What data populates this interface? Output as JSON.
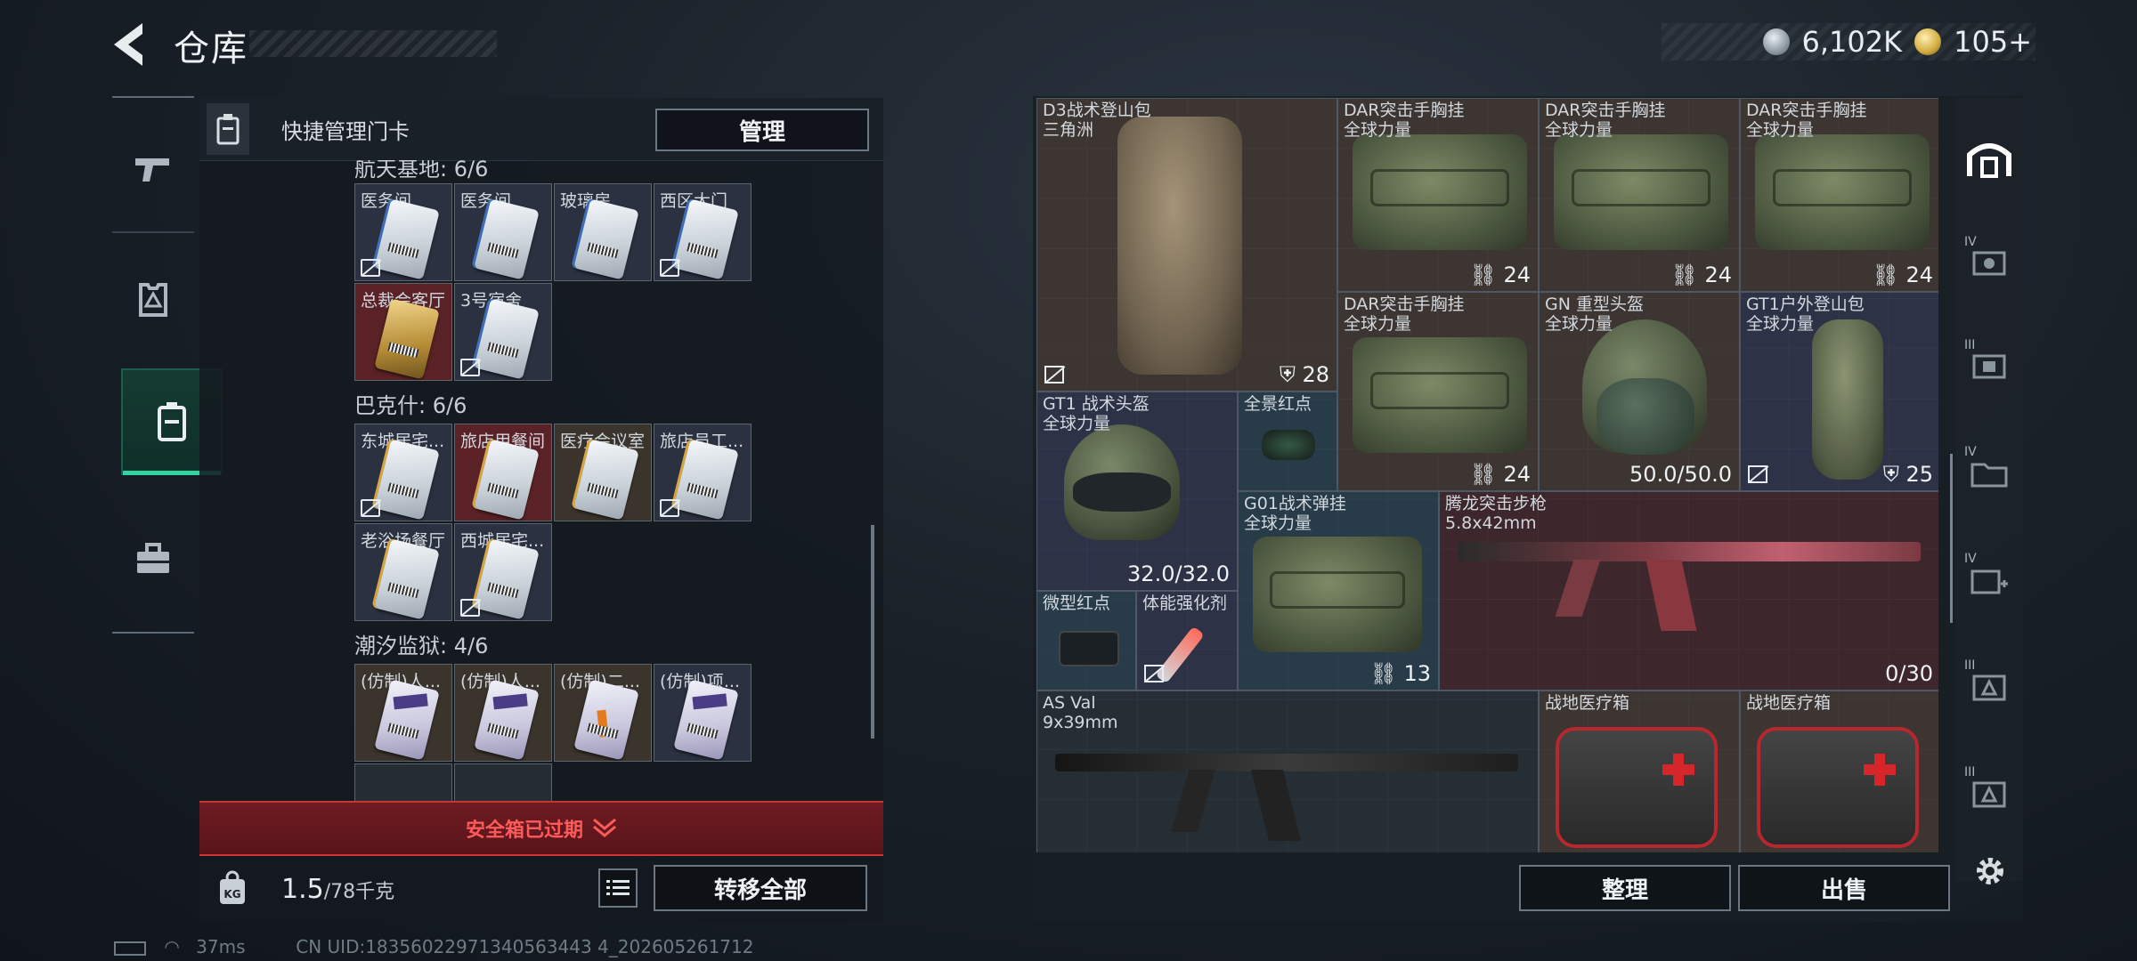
{
  "header": {
    "title": "仓库"
  },
  "currency": {
    "coins": "6,102K",
    "gold": "105+"
  },
  "left_nav": {
    "items": [
      "weapon-icon",
      "armor-icon",
      "keycard-icon",
      "toolbox-icon"
    ]
  },
  "left_panel": {
    "header_label": "快捷管理门卡",
    "manage_label": "管理",
    "sections": [
      {
        "title": "航天基地: 6/6",
        "cards": [
          "医务间",
          "医务间",
          "玻璃房",
          "西区大门",
          "总裁会客厅",
          "3号宿舍"
        ]
      },
      {
        "title": "巴克什: 6/6",
        "cards": [
          "东城居宅...",
          "旅店用餐间",
          "医疗会议室",
          "旅店员工...",
          "老浴场餐厅",
          "西城居宅..."
        ]
      },
      {
        "title": "潮汐监狱: 4/6",
        "cards": [
          "(仿制)人...",
          "(仿制)人...",
          "(仿制)二...",
          "(仿制)项..."
        ]
      }
    ],
    "expired_label": "安全箱已过期",
    "weight_value": "1.5",
    "weight_total": "/78千克",
    "transfer_label": "转移全部"
  },
  "status": {
    "ping": "37ms",
    "uid": "CN UID:18356022971340563443 4_202605261712"
  },
  "items": [
    {
      "name": "D3战术登山包",
      "sub": "三角洲",
      "badge": "28"
    },
    {
      "name": "DAR突击手胸挂",
      "sub": "全球力量",
      "badge": "24"
    },
    {
      "name": "DAR突击手胸挂",
      "sub": "全球力量",
      "badge": "24"
    },
    {
      "name": "DAR突击手胸挂",
      "sub": "全球力量",
      "badge": "24"
    },
    {
      "name": "DAR突击手胸挂",
      "sub": "全球力量",
      "badge": "24"
    },
    {
      "name": "GN 重型头盔",
      "sub": "全球力量",
      "badge": "50.0/50.0"
    },
    {
      "name": "GT1户外登山包",
      "sub": "全球力量",
      "badge": "25"
    },
    {
      "name": "GT1 战术头盔",
      "sub": "全球力量",
      "badge": "32.0/32.0"
    },
    {
      "name": "全景红点",
      "sub": "",
      "badge": ""
    },
    {
      "name": "G01战术弹挂",
      "sub": "全球力量",
      "badge": "13"
    },
    {
      "name": "腾龙突击步枪",
      "sub": "5.8x42mm",
      "badge": "0/30"
    },
    {
      "name": "微型红点",
      "sub": "",
      "badge": ""
    },
    {
      "name": "体能强化剂",
      "sub": "",
      "badge": ""
    },
    {
      "name": "AS Val",
      "sub": "9x39mm",
      "badge": ""
    },
    {
      "name": "战地医疗箱",
      "sub": "",
      "badge": ""
    },
    {
      "name": "战地医疗箱",
      "sub": "",
      "badge": ""
    }
  ],
  "right_nav": {
    "levels": [
      "IV",
      "III",
      "IV",
      "IV",
      "III",
      "III"
    ]
  },
  "buttons": {
    "sort_label": "整理",
    "sell_label": "出售"
  }
}
